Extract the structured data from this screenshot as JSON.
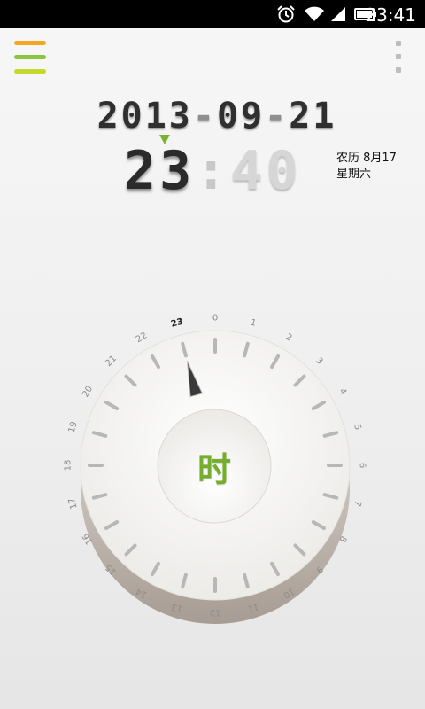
{
  "status_bar": {
    "time": "23:41",
    "icons": [
      "alarm-icon",
      "wifi-icon",
      "signal-icon",
      "battery-icon"
    ]
  },
  "toolbar": {
    "menu_icon": "hamburger-menu-icon",
    "more_icon": "overflow-menu-icon",
    "menu_colors": [
      "#f5a623",
      "#8cc63f",
      "#c4d82e"
    ]
  },
  "date": {
    "year": "2013",
    "month": "09",
    "day": "21",
    "separator": "-"
  },
  "time": {
    "hour": "23",
    "separator": ":",
    "minute": "40"
  },
  "lunar": {
    "lunar_date": "农历 8月17",
    "weekday": "星期六"
  },
  "dial": {
    "mode_label": "时",
    "labels": [
      "0",
      "1",
      "2",
      "3",
      "4",
      "5",
      "6",
      "7",
      "8",
      "9",
      "10",
      "11",
      "12",
      "13",
      "14",
      "15",
      "16",
      "17",
      "18",
      "19",
      "20",
      "21",
      "22",
      "23"
    ],
    "selected_hour": 23,
    "pointer_hour": 23
  },
  "colors": {
    "accent": "#75ad2f",
    "marker": "#7ab42d"
  }
}
